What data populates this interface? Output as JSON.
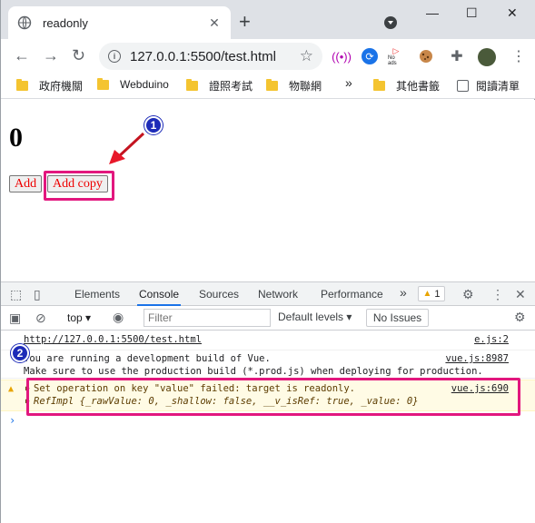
{
  "browser": {
    "tab_title": "readonly",
    "url": "127.0.0.1:5500/test.html",
    "bookmarks": [
      {
        "label": "政府機關"
      },
      {
        "label": "Webduino"
      },
      {
        "label": "證照考試"
      },
      {
        "label": "物聯網"
      }
    ],
    "bookmarks_more": "»",
    "other_bookmarks": "其他書籤",
    "reading_list": "閱讀清單",
    "ext_noads_label": "No ads"
  },
  "page": {
    "counter": "0",
    "add_label": "Add",
    "add_copy_label": "Add copy"
  },
  "annotations": {
    "badge1": "1",
    "badge2": "2",
    "highlight_color": "#e2177e",
    "arrow_color": "#e8182a"
  },
  "devtools": {
    "tabs": [
      "Elements",
      "Console",
      "Sources",
      "Network",
      "Performance"
    ],
    "active_tab": "Console",
    "more_tabs": "»",
    "warning_count": "1",
    "context": "top",
    "filter_placeholder": "Filter",
    "levels": "Default levels ▾",
    "issues": "No Issues",
    "console": {
      "line1_text": "http://127.0.0.1:5500/test.html",
      "line1_src": "e.js:2",
      "line2_text": "You are running a development build of Vue.",
      "line2_src": "vue.js:8987",
      "line3_text": "Make sure to use the production build (*.prod.js) when deploying for production.",
      "warn_text": "Set operation on key \"value\" failed: target is readonly.",
      "warn_src": "vue.js:690",
      "ref_text": "RefImpl {_rawValue: 0, _shallow: false, __v_isRef: true, _value: 0}"
    }
  }
}
